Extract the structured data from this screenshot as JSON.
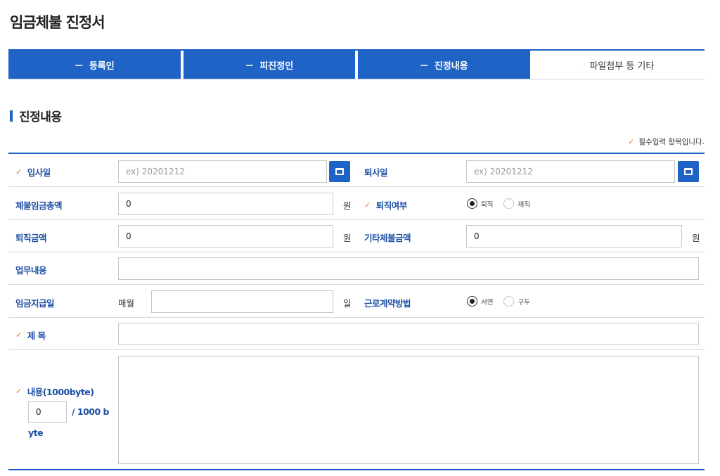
{
  "page": {
    "title": "임금체불 진정서"
  },
  "tabs": [
    {
      "prefix": "－",
      "label": "등록인"
    },
    {
      "prefix": "－",
      "label": "피진정인"
    },
    {
      "prefix": "－",
      "label": "진정내용"
    },
    {
      "prefix": "·",
      "label": "파일첨부 등 기타"
    }
  ],
  "section": {
    "title": "진정내용",
    "required_note": "필수입력 항목입니다."
  },
  "form": {
    "hire_date": {
      "label": "입사일",
      "placeholder": "ex) 20201212",
      "value": ""
    },
    "leave_date": {
      "label": "퇴사일",
      "placeholder": "ex) 20201212",
      "value": ""
    },
    "total_unpaid": {
      "label": "체불임금총액",
      "value": "0",
      "unit": "원"
    },
    "retired": {
      "label": "퇴직여부",
      "options": [
        "퇴직",
        "재직"
      ],
      "selected": "퇴직"
    },
    "severance": {
      "label": "퇴직금액",
      "value": "0",
      "unit": "원"
    },
    "other_unpaid": {
      "label": "기타체불금액",
      "value": "0",
      "unit": "원"
    },
    "job_desc": {
      "label": "업무내용",
      "value": ""
    },
    "pay_day": {
      "label": "임금지급일",
      "prefix": "매월",
      "value": "",
      "unit": "일"
    },
    "contract_method": {
      "label": "근로계약방법",
      "options": [
        "서면",
        "구두"
      ],
      "selected": "서면"
    },
    "subject": {
      "label": "제 목",
      "value": ""
    },
    "content": {
      "label": "내용(1000byte)",
      "count": "0",
      "limit_line1": "/ 1000 b",
      "limit_line2": "yte",
      "value": ""
    }
  },
  "icons": {
    "required": "check-icon",
    "calendar": "calendar-icon"
  },
  "colors": {
    "primary": "#1f63c6",
    "label": "#1d4fa3",
    "required_mark": "#e8732c"
  }
}
